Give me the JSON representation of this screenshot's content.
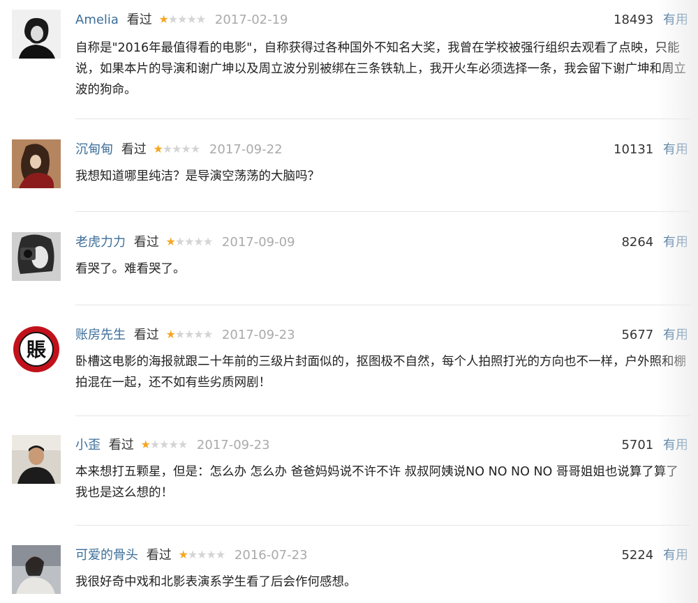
{
  "comments": [
    {
      "user": "Amelia",
      "status": "看过",
      "rating": 1,
      "date": "2017-02-19",
      "votes": "18493",
      "useful_label": "有用",
      "text": "自称是\"2016年最值得看的电影\"，自称获得过各种国外不知名大奖，我曾在学校被强行组织去观看了点映，只能说，如果本片的导演和谢广坤以及周立波分别被绑在三条铁轨上，我开火车必须选择一条，我会留下谢广坤和周立波的狗命。"
    },
    {
      "user": "沉甸甸",
      "status": "看过",
      "rating": 1,
      "date": "2017-09-22",
      "votes": "10131",
      "useful_label": "有用",
      "text": "我想知道哪里纯洁？是导演空荡荡的大脑吗？"
    },
    {
      "user": "老虎力力",
      "status": "看过",
      "rating": 1,
      "date": "2017-09-09",
      "votes": "8264",
      "useful_label": "有用",
      "text": "看哭了。难看哭了。"
    },
    {
      "user": "账房先生",
      "status": "看过",
      "rating": 1,
      "date": "2017-09-23",
      "votes": "5677",
      "useful_label": "有用",
      "text": "卧槽这电影的海报就跟二十年前的三级片封面似的，抠图极不自然，每个人拍照打光的方向也不一样，户外照和棚拍混在一起，还不如有些劣质网剧！"
    },
    {
      "user": "小歪",
      "status": "看过",
      "rating": 1,
      "date": "2017-09-23",
      "votes": "5701",
      "useful_label": "有用",
      "text": "本来想打五颗星，但是：怎么办 怎么办 爸爸妈妈说不许不许 叔叔阿姨说NO NO NO NO 哥哥姐姐也说算了算了 我也是这么想的！"
    },
    {
      "user": "可爱的骨头",
      "status": "看过",
      "rating": 1,
      "date": "2016-07-23",
      "votes": "5224",
      "useful_label": "有用",
      "text": "我很好奇中戏和北影表演系学生看了后会作何感想。"
    }
  ],
  "avatar_seal_text": "賬",
  "colors": {
    "username": "#3d6e99",
    "star_on": "#f5a623",
    "star_off": "#d4d4d4",
    "date": "#aaaaaa"
  }
}
